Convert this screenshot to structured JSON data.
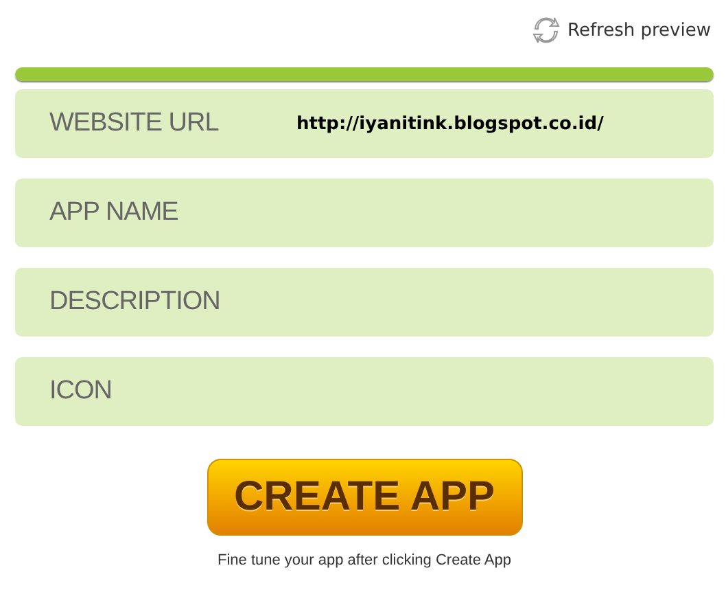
{
  "refresh": {
    "label": "Refresh preview"
  },
  "progress": {
    "level": 1
  },
  "fields": [
    {
      "label": "WEBSITE URL",
      "value": "http://iyanitink.blogspot.co.id/"
    },
    {
      "label": "APP NAME"
    },
    {
      "label": "DESCRIPTION"
    },
    {
      "label": "ICON"
    }
  ],
  "create_button": {
    "label": "CREATE APP"
  },
  "hint": "Fine tune your app after clicking Create App"
}
